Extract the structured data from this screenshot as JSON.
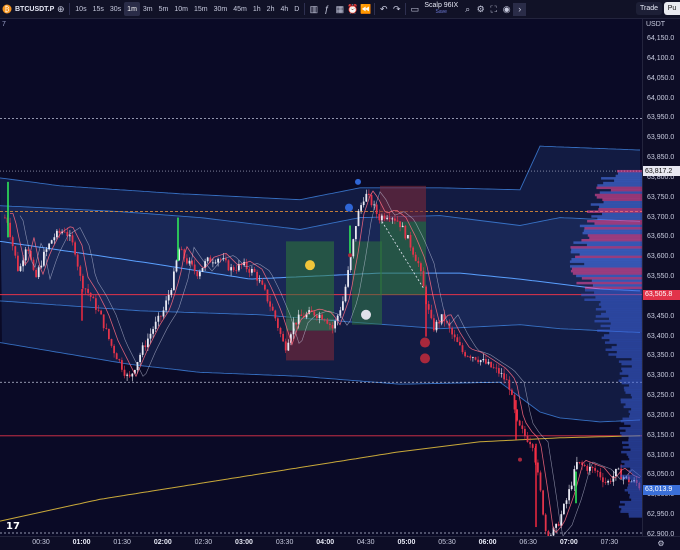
{
  "toolbar": {
    "symbol": "BTCUSDT.P",
    "intervals": [
      "10s",
      "15s",
      "30s",
      "1m",
      "3m",
      "5m",
      "10m",
      "15m",
      "30m",
      "45m",
      "1h",
      "2h",
      "4h",
      "D"
    ],
    "active_interval": "1m",
    "strategy_name": "Scalp 96IX",
    "strategy_sub": "Save",
    "trade_label": "Trade",
    "buy_label": "Pu"
  },
  "legend_number": "7",
  "currency": "USDT",
  "price_axis": {
    "labels": [
      "64,150.0",
      "64,100.0",
      "64,050.0",
      "64,000.0",
      "63,950.0",
      "63,900.0",
      "63,850.0",
      "63,800.0",
      "63,750.0",
      "63,700.0",
      "63,650.0",
      "63,600.0",
      "63,550.0",
      "63,500.0",
      "63,450.0",
      "63,400.0",
      "63,350.0",
      "63,300.0",
      "63,250.0",
      "63,200.0",
      "63,150.0",
      "63,100.0",
      "63,050.0",
      "63,000.0",
      "62,950.0",
      "62,900.0"
    ],
    "top_value": 64150,
    "bottom_value": 62900,
    "tags": [
      {
        "value": "63,817.2",
        "price": 63817.2,
        "bg": "#e8e8f2",
        "fg": "#111111"
      },
      {
        "value": "63,505.8",
        "price": 63505.8,
        "bg": "#e2334a",
        "fg": "#ffffff"
      },
      {
        "value": "63,013.9",
        "price": 63013.9,
        "bg": "#3a6fd8",
        "fg": "#ffffff"
      }
    ]
  },
  "time_axis": {
    "labels": [
      {
        "text": "00:30",
        "bold": false
      },
      {
        "text": "01:00",
        "bold": true
      },
      {
        "text": "01:30",
        "bold": false
      },
      {
        "text": "02:00",
        "bold": true
      },
      {
        "text": "02:30",
        "bold": false
      },
      {
        "text": "03:00",
        "bold": true
      },
      {
        "text": "03:30",
        "bold": false
      },
      {
        "text": "04:00",
        "bold": true
      },
      {
        "text": "04:30",
        "bold": false
      },
      {
        "text": "05:00",
        "bold": true
      },
      {
        "text": "05:30",
        "bold": false
      },
      {
        "text": "06:00",
        "bold": true
      },
      {
        "text": "06:30",
        "bold": false
      },
      {
        "text": "07:00",
        "bold": true
      },
      {
        "text": "07:30",
        "bold": false
      }
    ]
  },
  "colors": {
    "background": "#0a0a26",
    "band_fill": "#1a2a5a",
    "band_line": "#3d7fd9",
    "candle_up": "#e8e8f2",
    "candle_down": "#e2334a",
    "vwap": "#c9a93a",
    "red_level": "#e2334a",
    "orange_level": "#d98a3a",
    "white_dotted": "#bfc3da"
  }
}
